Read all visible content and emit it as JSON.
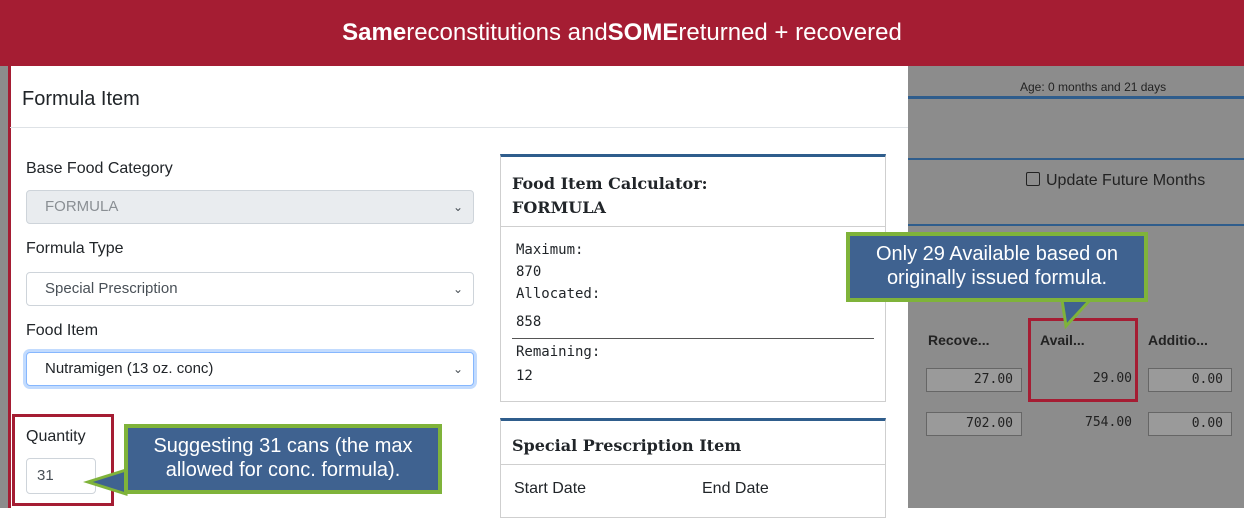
{
  "banner": {
    "part1": "Same",
    "part2": " reconstitutions and ",
    "part3": "SOME",
    "part4": " returned + recovered"
  },
  "background": {
    "age": "Age: 0 months and 21 days",
    "update_future_months": "Update Future Months",
    "table": {
      "headers": [
        "Recove...",
        "Avail...",
        "Additio..."
      ],
      "rows": [
        [
          "27.00",
          "29.00",
          "0.00"
        ],
        [
          "702.00",
          "754.00",
          "0.00"
        ]
      ]
    }
  },
  "modal": {
    "title": "Formula Item",
    "base_food_category": {
      "label": "Base Food Category",
      "value": "FORMULA"
    },
    "formula_type": {
      "label": "Formula Type",
      "value": "Special Prescription"
    },
    "food_item": {
      "label": "Food Item",
      "value": "Nutramigen (13 oz. conc)"
    },
    "quantity": {
      "label": "Quantity",
      "value": "31"
    },
    "calculator": {
      "title_line1": "Food Item Calculator:",
      "title_line2": "FORMULA",
      "maximum_label": "Maximum:",
      "maximum_value": "870",
      "allocated_label": "Allocated:",
      "allocated_value": "858",
      "remaining_label": "Remaining:",
      "remaining_value": "12"
    },
    "special_prescription": {
      "title": "Special Prescription Item",
      "start_date_label": "Start Date",
      "end_date_label": "End Date"
    }
  },
  "callouts": {
    "available": {
      "line1": "Only 29 Available based on",
      "line2": "originally issued formula."
    },
    "quantity": {
      "line1": "Suggesting 31 cans (the max",
      "line2": "allowed for conc. formula)."
    }
  },
  "colors": {
    "banner": "#a51d33",
    "highlight_box": "#a51d33",
    "callout_bg": "#3f6290",
    "callout_border": "#7fb33a"
  }
}
